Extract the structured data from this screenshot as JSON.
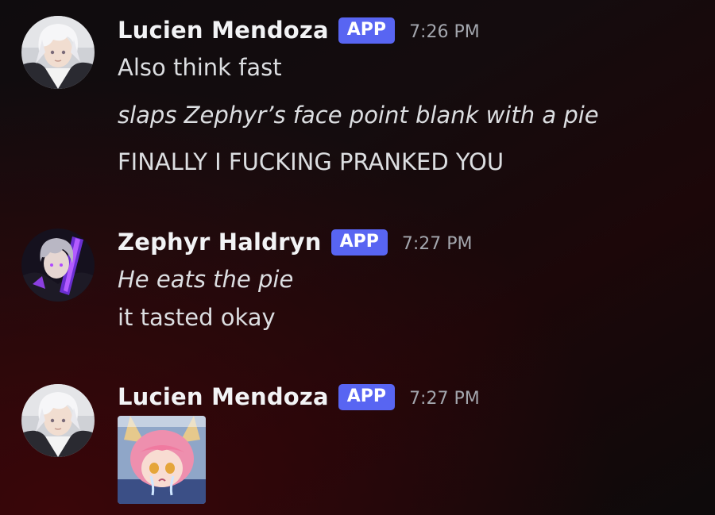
{
  "messages": [
    {
      "author": "Lucien Mendoza",
      "badge": "APP",
      "time": "7:26 PM",
      "avatar_icon": "white-haired-character-avatar-icon",
      "lines": [
        {
          "text": "Also think fast",
          "italic": false
        },
        {
          "text": "slaps Zephyr’s face point blank with a pie",
          "italic": true
        },
        {
          "text": "FINALLY I FUCKING PRANKED YOU",
          "italic": false
        }
      ]
    },
    {
      "author": "Zephyr Haldryn",
      "badge": "APP",
      "time": "7:27 PM",
      "avatar_icon": "dark-armored-character-avatar-icon",
      "lines": [
        {
          "text": "He eats the pie",
          "italic": true
        },
        {
          "text": "it tasted okay",
          "italic": false
        }
      ]
    },
    {
      "author": "Lucien Mendoza",
      "badge": "APP",
      "time": "7:27 PM",
      "avatar_icon": "white-haired-character-avatar-icon",
      "attachment_icon": "crying-pink-haired-foxgirl-image-icon"
    }
  ],
  "colors": {
    "badge_bg": "#5865f2",
    "username": "#f2f3f5",
    "message_text": "#dcdee1",
    "timestamp": "#a3a6ad",
    "background_accent": "#3a0609"
  }
}
